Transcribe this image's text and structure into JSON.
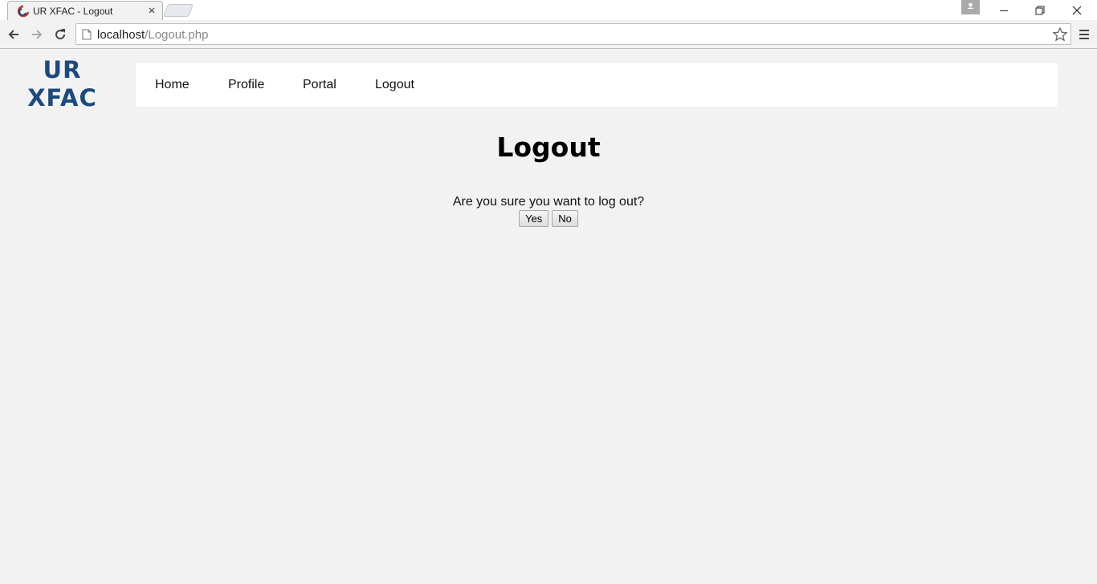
{
  "browser": {
    "tab_title": "UR XFAC - Logout",
    "url_host": "localhost",
    "url_path": "/Logout.php"
  },
  "site": {
    "logo_line1": "UR",
    "logo_line2": "XFAC",
    "logo_color": "#1c4a80",
    "nav": {
      "home": "Home",
      "profile": "Profile",
      "portal": "Portal",
      "logout": "Logout"
    }
  },
  "main": {
    "title": "Logout",
    "confirm_text": "Are you sure you want to log out?",
    "yes_label": "Yes",
    "no_label": "No"
  }
}
